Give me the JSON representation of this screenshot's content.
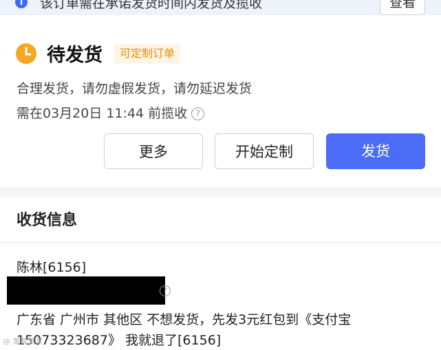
{
  "banner": {
    "info_icon": "info-icon",
    "text": "该订单需在承诺发货时间内发货及揽收",
    "view_button": "查看"
  },
  "status": {
    "clock_icon": "clock-icon",
    "title": "待发货",
    "badge": "可定制订单",
    "hint": "合理发货，请勿虚假发货，请勿延迟发货",
    "deadline": "需在03月20日 11:44 前揽收",
    "help_icon_glyph": "?"
  },
  "actions": {
    "more": "更多",
    "start_custom": "开始定制",
    "ship": "发货"
  },
  "receiver": {
    "section_title": "收货信息",
    "name": "陈林[6156]",
    "address_line1": "广东省 广州市 其他区 不想发货，先发3元红包到《支付宝",
    "address_line2": "15073323687》 我就退了[6156]"
  },
  "watermark": "@ 某某某某",
  "colors": {
    "accent": "#4a6cf7",
    "badge_orange": "#f08c00",
    "clock_orange": "#f5a623"
  }
}
